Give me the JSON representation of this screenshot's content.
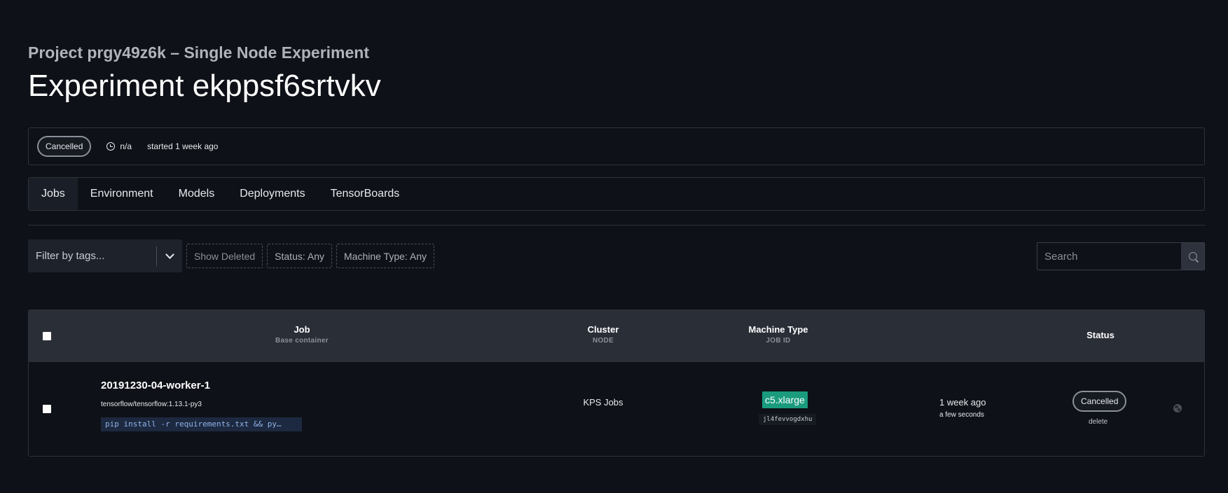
{
  "header": {
    "project_title": "Project prgy49z6k – Single Node Experiment",
    "experiment_title": "Experiment ekppsf6srtvkv"
  },
  "info": {
    "status": "Cancelled",
    "duration": "n/a",
    "started": "started 1 week ago"
  },
  "tabs": [
    {
      "label": "Jobs",
      "active": true
    },
    {
      "label": "Environment"
    },
    {
      "label": "Models"
    },
    {
      "label": "Deployments"
    },
    {
      "label": "TensorBoards"
    }
  ],
  "filters": {
    "tags_placeholder": "Filter by tags...",
    "show_deleted": "Show Deleted",
    "status": "Status: Any",
    "machine_type": "Machine Type: Any",
    "search_placeholder": "Search"
  },
  "table": {
    "headers": {
      "job": "Job",
      "job_sub": "Base container",
      "cluster": "Cluster",
      "cluster_sub": "NODE",
      "machine": "Machine Type",
      "machine_sub": "JOB ID",
      "status": "Status"
    },
    "rows": [
      {
        "name": "20191230-04-worker-1",
        "container": "tensorflow/tensorflow:1.13.1-py3",
        "command": "pip install -r requirements.txt && py…",
        "cluster": "KPS Jobs",
        "machine_type": "c5.xlarge",
        "job_id": "jl4fevvogdxhu",
        "time": "1 week ago",
        "duration": "a few seconds",
        "status": "Cancelled",
        "delete_label": "delete"
      }
    ]
  },
  "colors": {
    "background": "#0e1117",
    "machine_badge": "#1a9b7e",
    "table_header": "#2a2e37"
  }
}
